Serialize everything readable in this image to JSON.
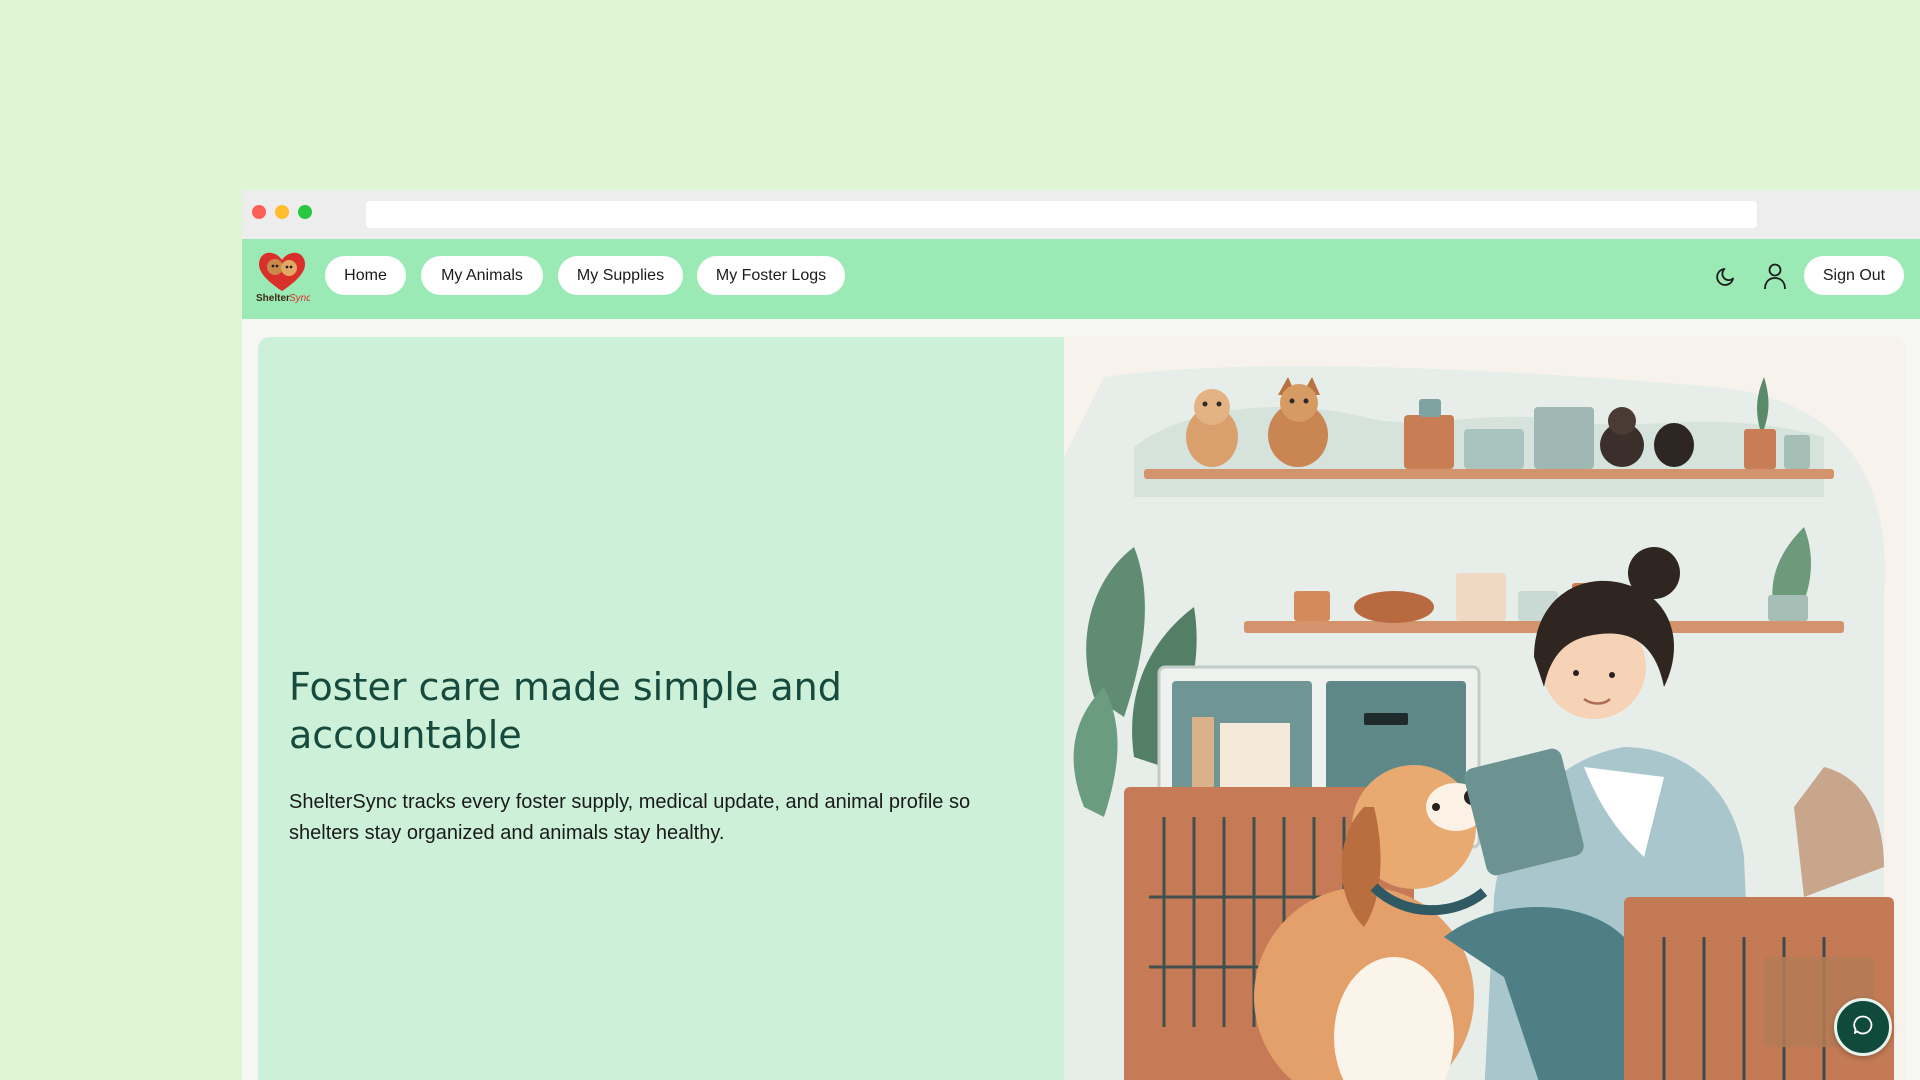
{
  "nav": {
    "logo_text": "ShelterSync",
    "items": [
      {
        "label": "Home"
      },
      {
        "label": "My Animals"
      },
      {
        "label": "My Supplies"
      },
      {
        "label": "My Foster Logs"
      }
    ],
    "sign_out_label": "Sign Out",
    "icons": [
      "moon-icon",
      "user-icon"
    ]
  },
  "hero": {
    "title": "Foster care made simple and accountable",
    "description": "ShelterSync tracks every foster supply, medical update, and animal profile so shelters stay organized and animals stay healthy.",
    "illustration": "foster-illustration"
  },
  "chat": {
    "icon": "chat-bubble-icon"
  },
  "colors": {
    "background": "#e0f5d4",
    "navbar": "#9beab5",
    "hero_panel": "#ccf0d8",
    "title_text": "#164a3c",
    "chat_button": "#0f4a3a"
  }
}
